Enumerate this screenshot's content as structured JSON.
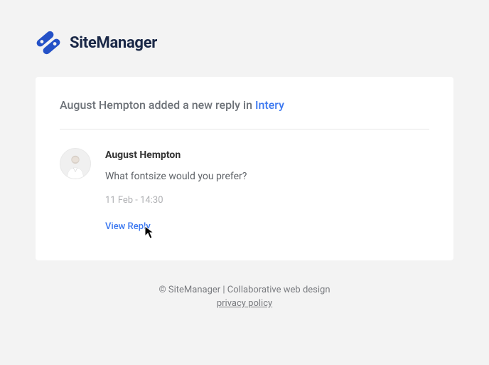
{
  "brand": {
    "name": "SiteManager"
  },
  "card": {
    "title_prefix": "August Hempton added a new reply in ",
    "title_link": "Intery"
  },
  "reply": {
    "author": "August Hempton",
    "message": "What fontsize would you prefer?",
    "timestamp": "11 Feb - 14:30",
    "view_link_label": "View Reply"
  },
  "footer": {
    "copyright": "© SiteManager | Collaborative web design",
    "privacy_label": "privacy policy"
  }
}
